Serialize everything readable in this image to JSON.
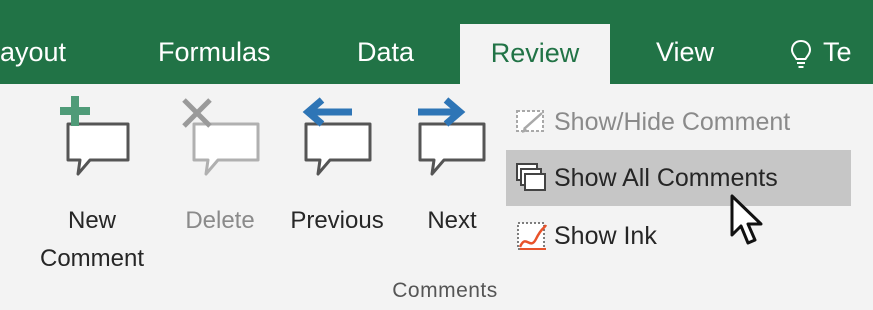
{
  "tabs": {
    "layout": "ayout",
    "formulas": "Formulas",
    "data": "Data",
    "review": "Review",
    "view": "View",
    "tell": "Te"
  },
  "comments_group": {
    "new_comment": {
      "line1": "New",
      "line2": "Comment",
      "icon": "new-comment-icon"
    },
    "delete": {
      "label": "Delete",
      "icon": "delete-comment-icon",
      "state": "disabled"
    },
    "previous": {
      "label": "Previous",
      "icon": "previous-comment-icon"
    },
    "next": {
      "label": "Next",
      "icon": "next-comment-icon"
    },
    "show_hide": {
      "label": "Show/Hide Comment",
      "icon": "show-hide-comment-icon",
      "state": "disabled"
    },
    "show_all": {
      "label": "Show All Comments",
      "icon": "show-all-comments-icon",
      "state": "hover"
    },
    "show_ink": {
      "label": "Show Ink",
      "icon": "show-ink-icon"
    },
    "group_label": "Comments"
  },
  "colors": {
    "tab_bar": "#217346",
    "ribbon": "#f3f3f3",
    "hover": "#c6c6c6",
    "new_accent": "#4f9b78",
    "arrow_accent": "#2e75b6",
    "ink_accent": "#e8532b"
  }
}
